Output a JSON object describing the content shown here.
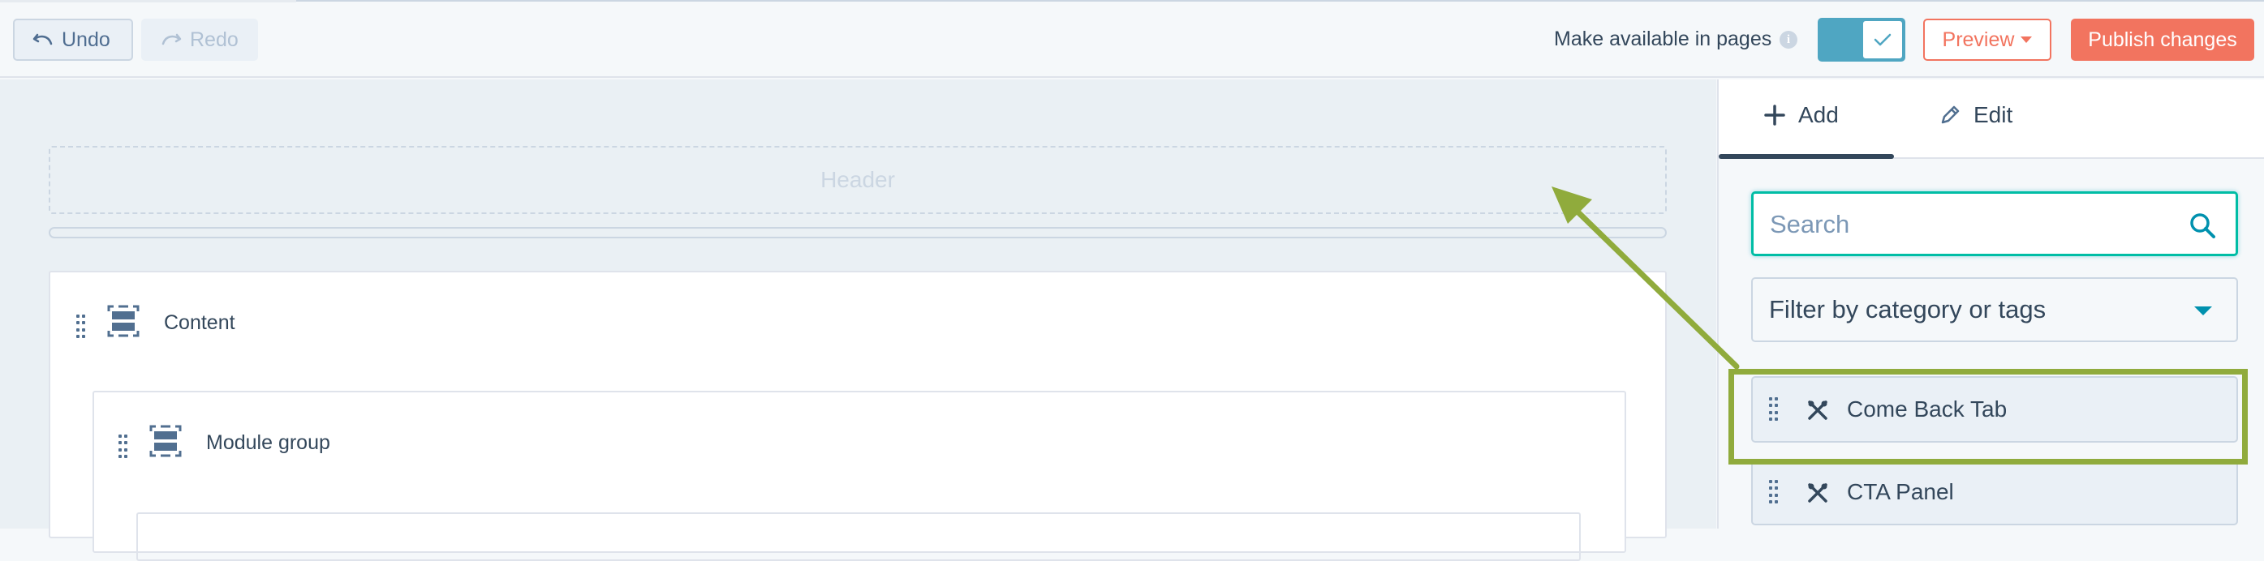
{
  "toolbar": {
    "undo_label": "Undo",
    "redo_label": "Redo",
    "make_available_label": "Make available in pages",
    "info_glyph": "i",
    "preview_label": "Preview",
    "publish_label": "Publish changes"
  },
  "canvas": {
    "header_label": "Header",
    "content_label": "Content",
    "module_group_label": "Module group"
  },
  "sidebar": {
    "tabs": [
      {
        "label": "Add",
        "active": true
      },
      {
        "label": "Edit",
        "active": false
      }
    ],
    "search_placeholder": "Search",
    "filter_label": "Filter by category or tags",
    "modules": [
      {
        "label": "Come Back Tab",
        "highlighted": true
      },
      {
        "label": "CTA Panel",
        "highlighted": false
      }
    ]
  },
  "colors": {
    "accent_teal": "#4fa6c2",
    "brand_orange": "#f2745f",
    "annotation_green": "#90ab3c",
    "text_dark": "#33475b"
  },
  "icons": [
    "undo-icon",
    "redo-icon",
    "info-icon",
    "check-icon",
    "caret-down-icon",
    "plus-icon",
    "pencil-icon",
    "search-icon",
    "drag-handle-icon",
    "section-icon",
    "wrench-scissors-icon"
  ]
}
